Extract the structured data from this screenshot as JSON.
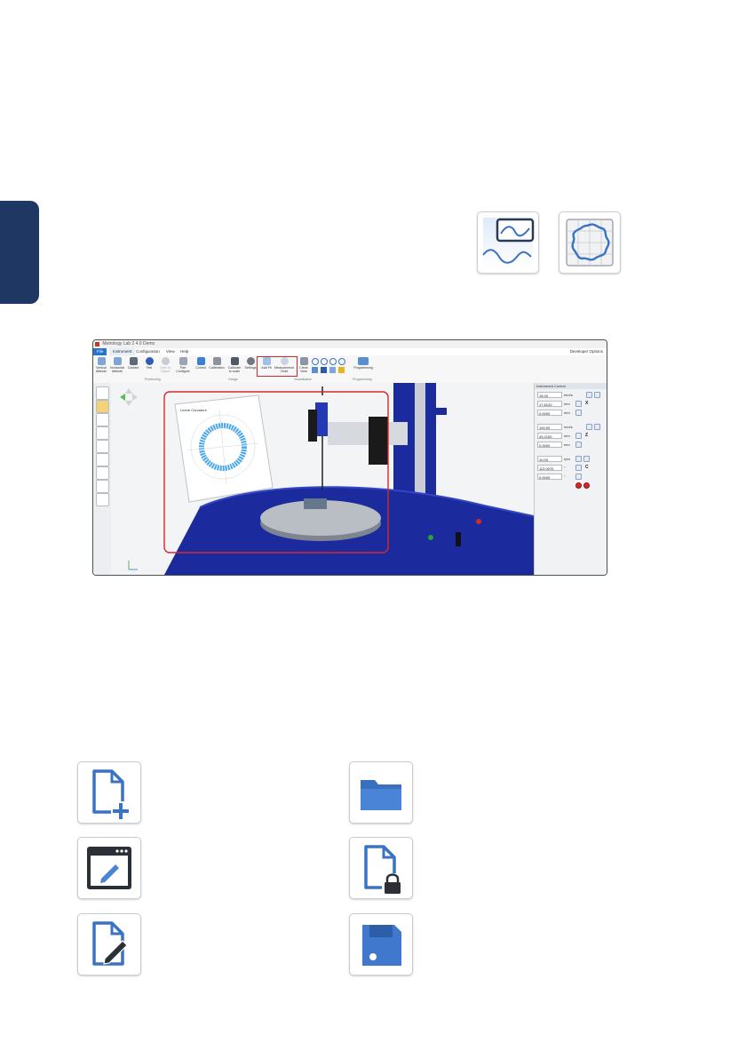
{
  "window": {
    "title": "Metrology Lab 2 4.0 Demo",
    "developer_options": "Developer Options"
  },
  "menu": {
    "file": "File",
    "instrument": "Instrument",
    "configuration": "Configuration",
    "view": "View",
    "help": "Help"
  },
  "ribbon": {
    "buttons": [
      "Vertical Attitude",
      "Horizontal Attitude",
      "Contact",
      "Test",
      "Over to Object",
      "Part Configure",
      "Control",
      "Calibration",
      "Calibrate to scale",
      "Settings",
      "Add Fit",
      "Measurement Chart",
      "Clean View",
      "",
      "",
      "",
      "",
      "Programming"
    ],
    "groups": [
      "Positioning",
      "Gauge",
      "Visualisation",
      "Programming"
    ]
  },
  "chart_overlay": {
    "title": "Linear Curvature"
  },
  "instrument_control": {
    "title": "Instrument Control",
    "x_speed": "15.00",
    "x_speed_unit": "mm/s",
    "x_pos": "17.8120",
    "x_pos_unit": "mm",
    "x_step": "0.0000",
    "x_step_unit": "mm",
    "x_label": "X",
    "z_speed": "100.00",
    "z_speed_unit": "mm/s",
    "z_pos": "43.2100",
    "z_pos_unit": "mm",
    "z_step": "0.0000",
    "z_step_unit": "mm",
    "z_label": "Z",
    "c_speed": "10.00",
    "c_speed_unit": "rpm",
    "c_pos": "113.0070",
    "c_pos_unit": "°",
    "c_step": "0.0000",
    "c_step_unit": "°",
    "c_label": "C"
  },
  "icons": {
    "profile_view": "profile-view-icon",
    "roundness_chart": "roundness-chart-icon",
    "new_file": "new-file-icon",
    "open_folder": "open-folder-icon",
    "edit_window": "edit-window-icon",
    "locked_file": "locked-file-icon",
    "edit_file": "edit-file-icon",
    "save": "save-floppy-icon"
  },
  "colors": {
    "sidebar_tab": "#1f3763",
    "icon_blue": "#3a72c4",
    "highlight_red": "#d9262c",
    "machine_blue": "#1a2a9c"
  }
}
